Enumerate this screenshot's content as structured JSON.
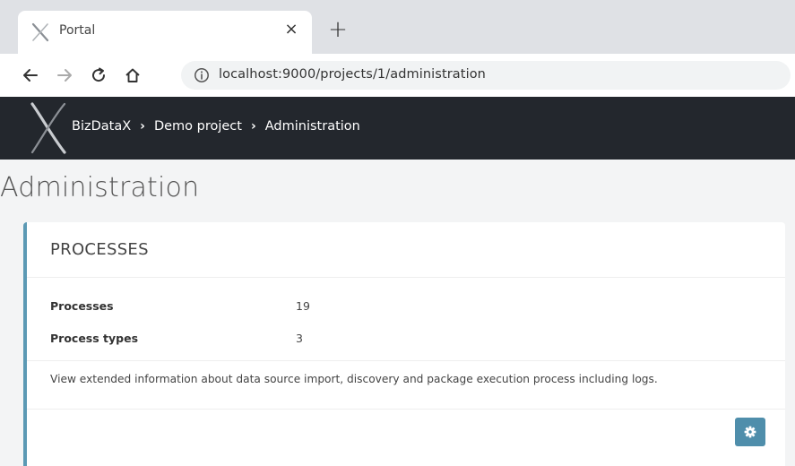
{
  "browser": {
    "tab_title": "Portal",
    "close_glyph": "×",
    "new_tab_glyph": "+",
    "url": "localhost:9000/projects/1/administration",
    "icons": [
      "back-arrow-icon",
      "forward-arrow-icon",
      "reload-icon",
      "home-icon",
      "info-icon"
    ]
  },
  "app": {
    "breadcrumbs": [
      {
        "label": "BizDataX"
      },
      {
        "label": "Demo project"
      },
      {
        "label": "Administration"
      }
    ],
    "separator": "›",
    "header_color": "#23272d"
  },
  "page": {
    "title": "Administration"
  },
  "processes_card": {
    "title": "PROCESSES",
    "rows": [
      {
        "label": "Processes",
        "value": "19"
      },
      {
        "label": "Process types",
        "value": "3"
      }
    ],
    "description": "View extended information about data source import, discovery and package execution process including logs.",
    "accent_color": "#5b99b4",
    "button_icon": "gear-icon",
    "button_color": "#4f8eab"
  }
}
